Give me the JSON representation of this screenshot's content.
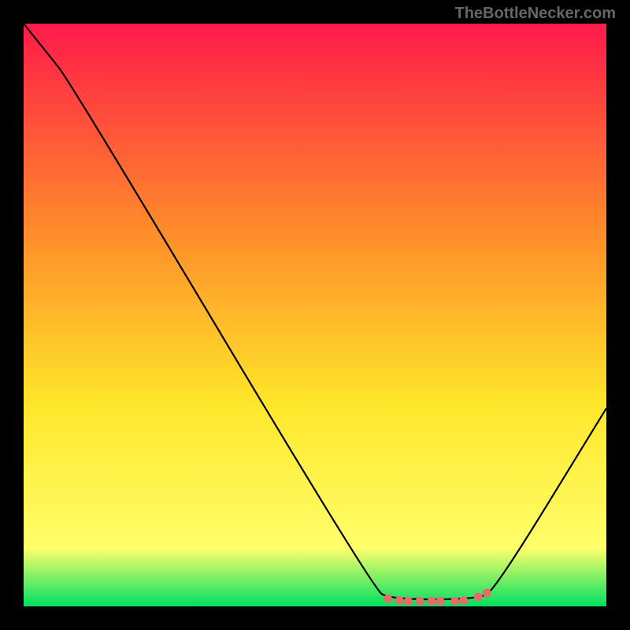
{
  "watermark": "TheBottleNecker.com",
  "chart_data": {
    "type": "line",
    "title": "",
    "xlabel": "",
    "ylabel": "",
    "xlim": [
      0,
      100
    ],
    "ylim": [
      0,
      100
    ],
    "gradient": {
      "top": "#ff1a4a",
      "mid1": "#ff8a2a",
      "mid2": "#ffe62a",
      "mid3": "#ffff6a",
      "bottom": "#00e060"
    },
    "curve": [
      {
        "x": 0,
        "y": 100
      },
      {
        "x": 4,
        "y": 95
      },
      {
        "x": 8,
        "y": 90
      },
      {
        "x": 60,
        "y": 3
      },
      {
        "x": 63,
        "y": 1.2
      },
      {
        "x": 78,
        "y": 1.2
      },
      {
        "x": 81,
        "y": 3
      },
      {
        "x": 100,
        "y": 34
      }
    ],
    "dots": [
      {
        "x": 62.5,
        "y": 1.3
      },
      {
        "x": 64.5,
        "y": 1.0
      },
      {
        "x": 66.0,
        "y": 0.9
      },
      {
        "x": 68.0,
        "y": 0.9
      },
      {
        "x": 70.0,
        "y": 0.9
      },
      {
        "x": 71.5,
        "y": 0.9
      },
      {
        "x": 74.0,
        "y": 0.9
      },
      {
        "x": 75.5,
        "y": 1.0
      },
      {
        "x": 78.0,
        "y": 1.6
      },
      {
        "x": 79.5,
        "y": 2.3
      }
    ],
    "dot_color": "#e86a6a"
  }
}
